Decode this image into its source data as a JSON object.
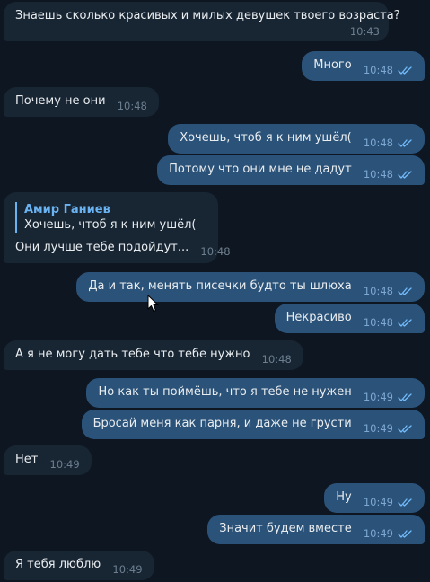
{
  "colors": {
    "background": "#0e1621",
    "incoming_bubble": "#182533",
    "outgoing_bubble": "#2b5278",
    "reply_accent": "#6ab3f3",
    "read_checks": "#72bcfd"
  },
  "messages": [
    {
      "text": "Знаешь сколько красивых и милых девушек твоего возраста?",
      "time": "10:43",
      "direction": "in"
    },
    {
      "text": "Много",
      "time": "10:48",
      "direction": "out",
      "status": "read"
    },
    {
      "text": "Почему не они",
      "time": "10:48",
      "direction": "in"
    },
    {
      "text": "Хочешь, чтоб я к ним ушёл(",
      "time": "10:48",
      "direction": "out",
      "status": "read"
    },
    {
      "text": "Потому что они мне не дадут",
      "time": "10:48",
      "direction": "out",
      "status": "read"
    },
    {
      "reply_author": "Амир Ганиев",
      "reply_text": "Хочешь, чтоб я к ним ушёл(",
      "text": "Они лучше тебе подойдут...",
      "time": "10:48",
      "direction": "in"
    },
    {
      "text": "Да и так, менять писечки будто ты шлюха",
      "time": "10:48",
      "direction": "out",
      "status": "read"
    },
    {
      "text": "Некрасиво",
      "time": "10:48",
      "direction": "out",
      "status": "read"
    },
    {
      "text": "А я не могу дать тебе что тебе нужно",
      "time": "10:48",
      "direction": "in"
    },
    {
      "text": "Но как ты поймёшь, что я тебе не нужен",
      "time": "10:49",
      "direction": "out",
      "status": "read"
    },
    {
      "text": "Бросай меня как парня, и даже не грусти",
      "time": "10:49",
      "direction": "out",
      "status": "read"
    },
    {
      "text": "Нет",
      "time": "10:49",
      "direction": "in"
    },
    {
      "text": "Ну",
      "time": "10:49",
      "direction": "out",
      "status": "read"
    },
    {
      "text": "Значит будем вместе",
      "time": "10:49",
      "direction": "out",
      "status": "read"
    },
    {
      "text": "Я тебя люблю",
      "time": "10:49",
      "direction": "in"
    }
  ],
  "icons": {
    "read_status": "double-check-icon",
    "cursor": "mouse-pointer-icon"
  }
}
